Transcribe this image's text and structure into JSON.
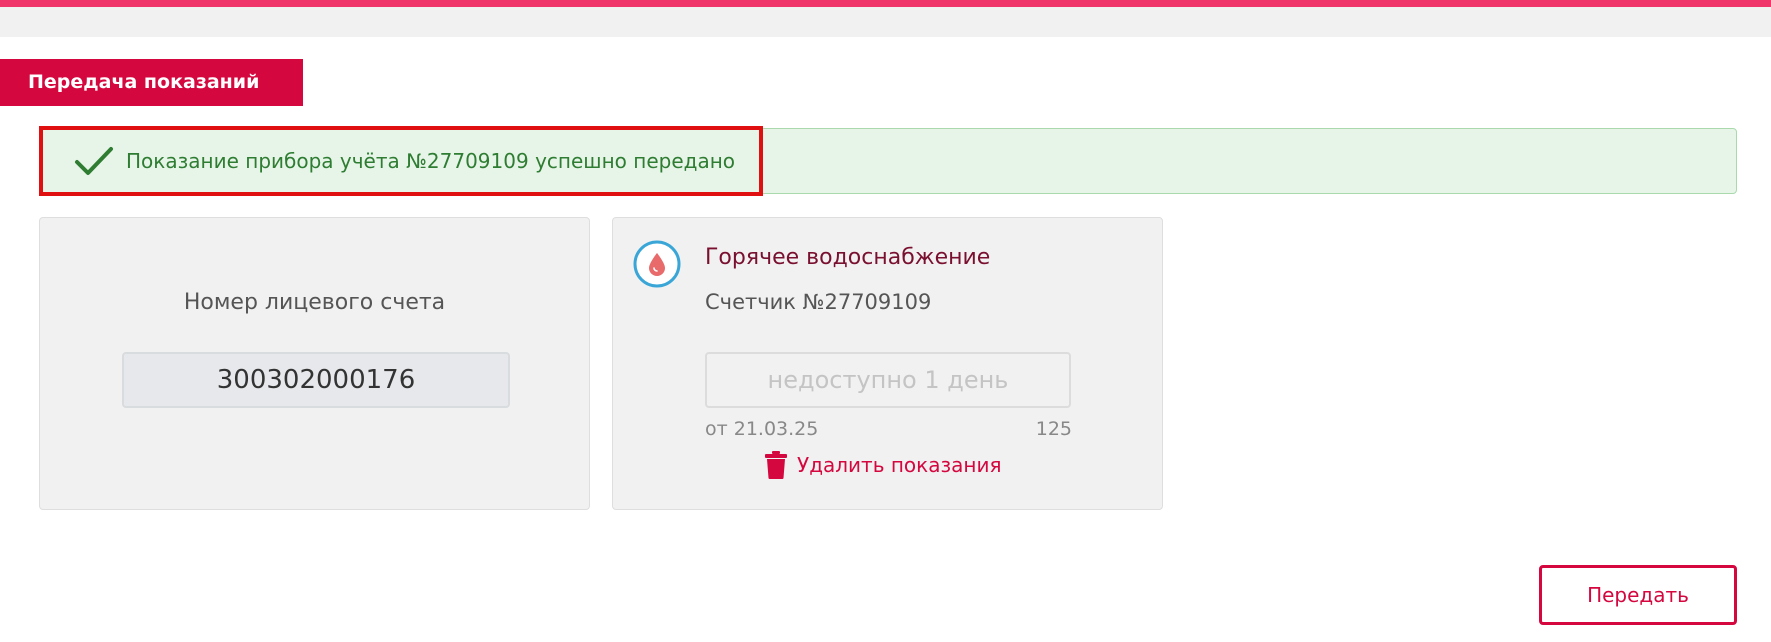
{
  "section": {
    "title": "Передача показаний"
  },
  "notification": {
    "message": "Показание прибора учёта №27709109 успешно передано",
    "icon": "checkmark-icon",
    "color": "#2e7d32"
  },
  "account_card": {
    "label": "Номер лицевого счета",
    "number": "300302000176"
  },
  "meter_card": {
    "icon": "water-drop-icon",
    "service": "Горячее водоснабжение",
    "meter_label": "Счетчик №27709109",
    "input_placeholder": "недоступно 1 день",
    "input_value": "",
    "previous_date": "от 21.03.25",
    "previous_value": "125",
    "delete_label": "Удалить показания"
  },
  "actions": {
    "submit_label": "Передать"
  },
  "colors": {
    "accent": "#d4073f",
    "top_stripe": "#f0356b",
    "success_bg": "#e7f5e8",
    "highlight": "#e01010",
    "icon_ring": "#3aa6d8"
  }
}
